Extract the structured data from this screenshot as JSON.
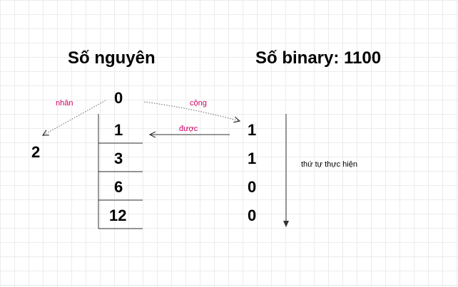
{
  "headings": {
    "integer": "Số nguyên",
    "binary": "Số binary: 1100"
  },
  "integer_column": {
    "start": "0",
    "values": [
      "1",
      "3",
      "6",
      "12"
    ]
  },
  "binary_column": {
    "digits": [
      "1",
      "1",
      "0",
      "0"
    ]
  },
  "multiplier": "2",
  "labels": {
    "multiply": "nhân",
    "add": "cộng",
    "result": "được",
    "order": "thứ tự thực hiện"
  },
  "colors": {
    "annotation": "#cc0066",
    "grid": "#ececec",
    "text": "#000000"
  }
}
